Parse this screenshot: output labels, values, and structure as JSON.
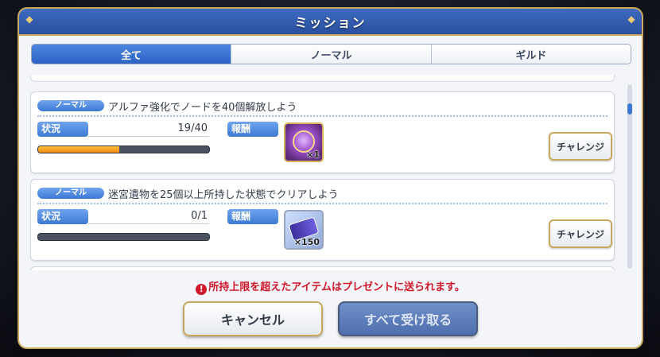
{
  "dialog": {
    "title": "ミッション"
  },
  "tabs": [
    {
      "label": "全て",
      "active": true
    },
    {
      "label": "ノーマル",
      "active": false
    },
    {
      "label": "ギルド",
      "active": false
    }
  ],
  "missions": [
    {
      "badge": "ノーマル",
      "text": "アルファ強化でノードを40個解放しよう",
      "status_label": "状況",
      "progress_text": "19/40",
      "progress_current": 19,
      "progress_total": 40,
      "reward_label": "報酬",
      "reward_icon": "gem-orb-icon",
      "reward_qty": "×1",
      "button": "チャレンジ"
    },
    {
      "badge": "ノーマル",
      "text": "迷宮遺物を25個以上所持した状態でクリアしよう",
      "status_label": "状況",
      "progress_text": "0/1",
      "progress_current": 0,
      "progress_total": 1,
      "reward_label": "報酬",
      "reward_icon": "ticket-icon",
      "reward_qty": "×150",
      "button": "チャレンジ"
    }
  ],
  "notice": {
    "icon": "!",
    "text": "所持上限を超えたアイテムはプレゼントに送られます。"
  },
  "buttons": {
    "cancel": "キャンセル",
    "receive_all": "すべて受け取る"
  },
  "colors": {
    "accent_blue": "#3d79d4",
    "gold_border": "#c8a85c",
    "progress_fill": "#f08a10",
    "warning_red": "#d0182a"
  }
}
